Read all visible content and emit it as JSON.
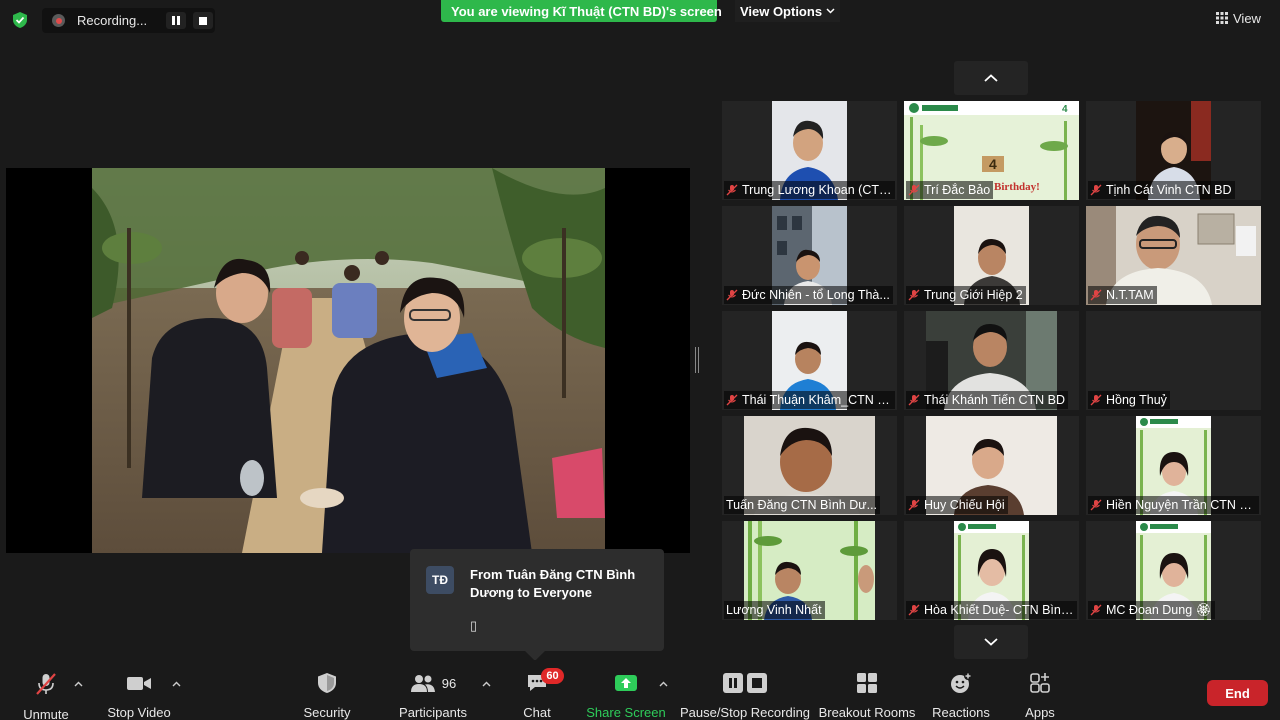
{
  "top": {
    "recording_label": "Recording...",
    "viewing_banner": "You are viewing Kĩ Thuật (CTN BD)'s screen",
    "view_options_label": "View Options",
    "view_label": "View"
  },
  "gallery": {
    "tiles": [
      {
        "name": "Trung Lương Khoan (CTN..."
      },
      {
        "name": "Trí Đắc Bảo"
      },
      {
        "name": "Tịnh Cát Vinh CTN BD"
      },
      {
        "name": "Đức Nhiên - tổ Long Thà..."
      },
      {
        "name": "Trung Giới Hiệp 2"
      },
      {
        "name": "N.T.TAM"
      },
      {
        "name": "Thái Thuận Khâm_CTN Bì..."
      },
      {
        "name": "Thái Khánh Tiến CTN BD"
      },
      {
        "name": "Hồng Thuỷ"
      },
      {
        "name": "Tuấn Đăng CTN Bình Dư..."
      },
      {
        "name": "Huy Chiếu Hội"
      },
      {
        "name": "Hiền Nguyện Trần CTN BD"
      },
      {
        "name": "Lương Vinh Nhất"
      },
      {
        "name": "Hòa Khiết Duệ- CTN Bình..."
      },
      {
        "name": "MC Đoan Dung 🏵"
      }
    ],
    "birthday_overlay": "Birthday!"
  },
  "chat_toast": {
    "avatar_initials": "TĐ",
    "from_text": "From Tuân Đăng CTN Bình Dương to Everyone",
    "message": "▯"
  },
  "toolbar": {
    "unmute": "Unmute",
    "stop_video": "Stop Video",
    "security": "Security",
    "participants": "Participants",
    "participants_count": "96",
    "chat": "Chat",
    "chat_badge": "60",
    "share_screen": "Share Screen",
    "pause_stop_recording": "Pause/Stop Recording",
    "breakout_rooms": "Breakout Rooms",
    "reactions": "Reactions",
    "apps": "Apps",
    "end": "End"
  },
  "colors": {
    "banner_green": "#2eb84b",
    "share_green": "#2ecc5a",
    "end_red": "#c9242a",
    "badge_red": "#e02828",
    "muted_mic_red": "#e04444"
  }
}
